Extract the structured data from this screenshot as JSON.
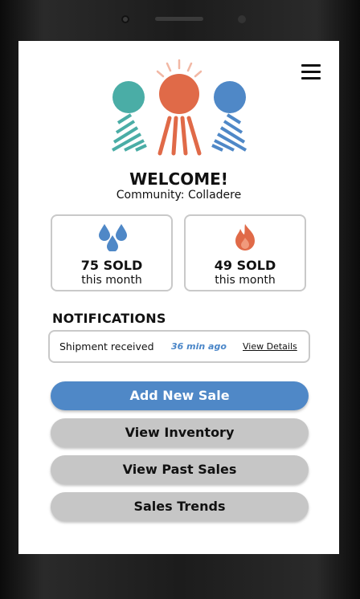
{
  "header": {
    "welcome": "WELCOME!",
    "community": "Community: Colladere",
    "menu_icon": "hamburger-menu-icon"
  },
  "stats": [
    {
      "count": "75 SOLD",
      "period": "this month",
      "icon": "water-drops-icon"
    },
    {
      "count": "49 SOLD",
      "period": "this month",
      "icon": "fire-icon"
    }
  ],
  "notifications": {
    "title": "NOTIFICATIONS",
    "items": [
      {
        "message": "Shipment received",
        "time": "36 min ago",
        "action": "View Details"
      }
    ]
  },
  "actions": {
    "add_new_sale": "Add New Sale",
    "view_inventory": "View Inventory",
    "view_past_sales": "View Past Sales",
    "sales_trends": "Sales Trends"
  },
  "colors": {
    "primary": "#4f88c7",
    "teal": "#4aada6",
    "orange": "#e06a48",
    "blue": "#4f88c7",
    "secondary_button": "#c6c6c6"
  }
}
